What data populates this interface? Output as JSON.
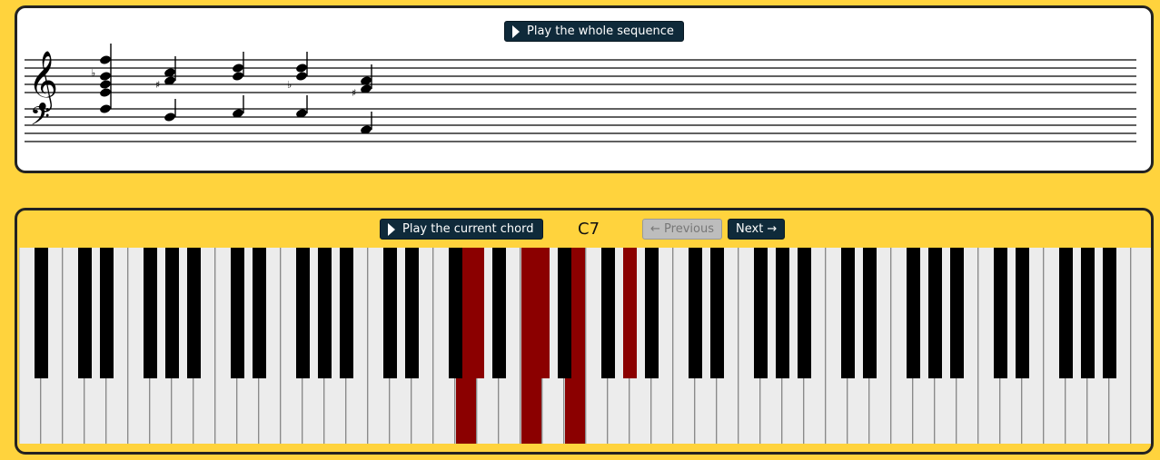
{
  "score": {
    "play_sequence_label": "Play the whole sequence"
  },
  "controls": {
    "play_chord_label": "Play the current chord",
    "chord_name": "C7",
    "previous_label": "← Previous",
    "next_label": "Next →"
  },
  "keyboard": {
    "white_key_count": 52,
    "highlighted_white_keys": [
      20,
      23,
      25
    ],
    "highlighted_black_keys": [
      14,
      16,
      19
    ]
  },
  "colors": {
    "background": "#FFD33D",
    "button": "#0F2A3A",
    "highlight": "#8B0000"
  }
}
